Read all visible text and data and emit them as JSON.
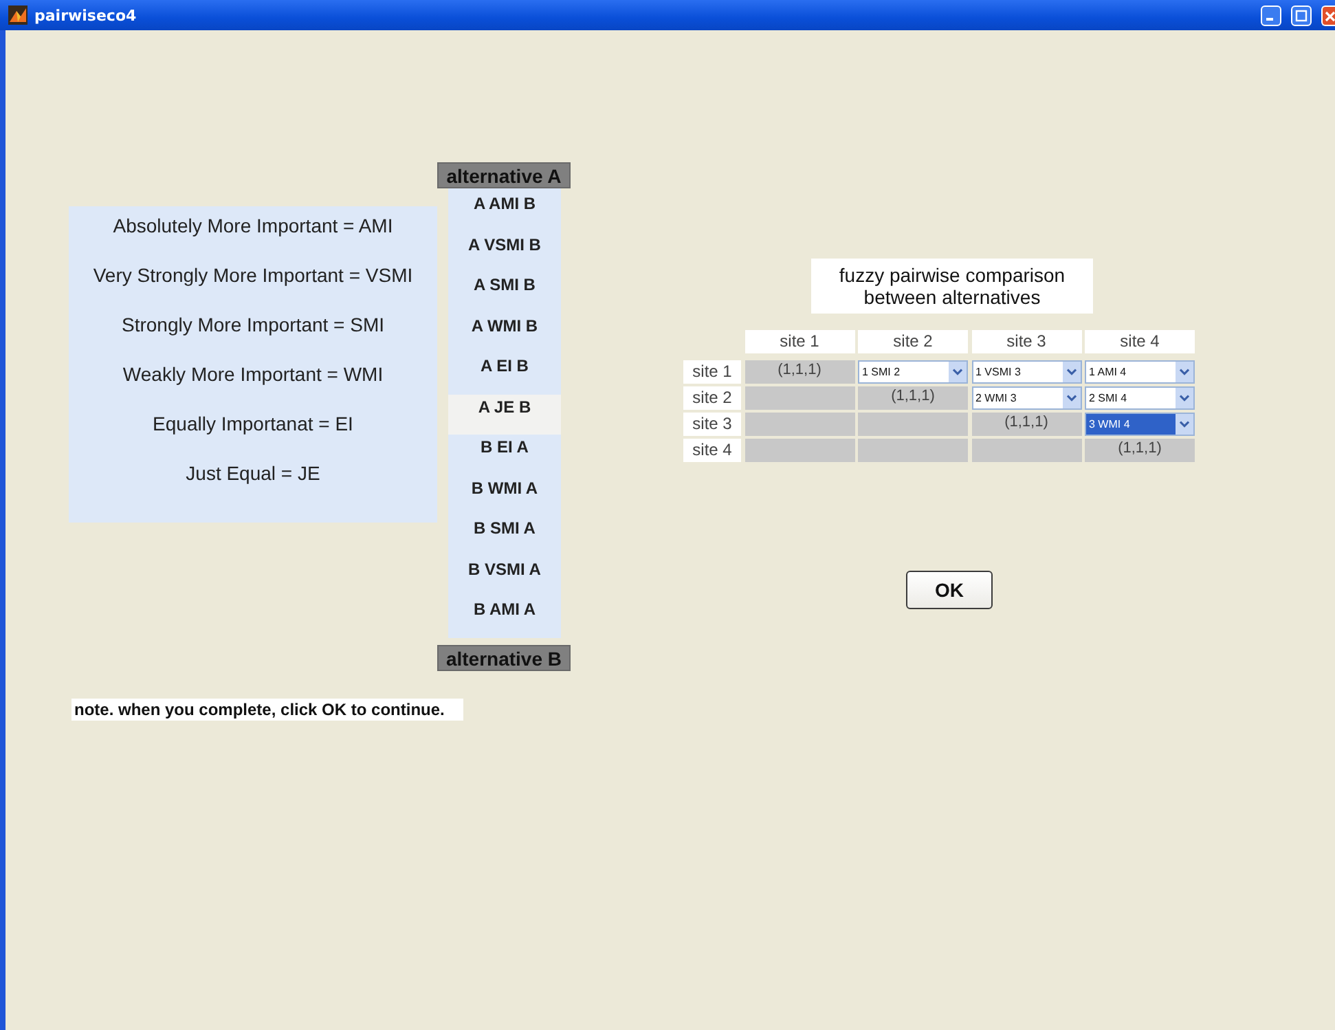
{
  "window": {
    "title": "pairwiseco4"
  },
  "legend": [
    "Absolutely More Important = AMI",
    "Very Strongly More Important = VSMI",
    "Strongly More Important = SMI",
    "Weakly More Important = WMI",
    "Equally Importanat = EI",
    "Just Equal = JE"
  ],
  "alternative_a": "alternative A",
  "scale_list": [
    {
      "label": "A AMI B",
      "selected": false
    },
    {
      "label": "A VSMI B",
      "selected": false
    },
    {
      "label": "A SMI B",
      "selected": false
    },
    {
      "label": "A WMI B",
      "selected": false
    },
    {
      "label": "A EI B",
      "selected": false
    },
    {
      "label": "A JE B",
      "selected": true
    },
    {
      "label": "B EI A",
      "selected": false
    },
    {
      "label": "B WMI A",
      "selected": false
    },
    {
      "label": "B SMI A",
      "selected": false
    },
    {
      "label": "B VSMI A",
      "selected": false
    },
    {
      "label": "B AMI A",
      "selected": false
    }
  ],
  "alternative_b": "alternative B",
  "note": "note. when you complete, click OK to continue.",
  "comparison_title": [
    "fuzzy pairwise comparison",
    "between alternatives"
  ],
  "table": {
    "columns": [
      "site 1",
      "site 2",
      "site 3",
      "site 4"
    ],
    "rows": [
      {
        "label": "site 1",
        "cells": [
          {
            "kind": "fixed",
            "text": "(1,1,1)"
          },
          {
            "kind": "dropdown",
            "text": "1 SMI 2",
            "focused": false
          },
          {
            "kind": "dropdown",
            "text": "1 VSMI 3",
            "focused": false
          },
          {
            "kind": "dropdown",
            "text": "1 AMI 4",
            "focused": false
          }
        ]
      },
      {
        "label": "site 2",
        "cells": [
          {
            "kind": "blank"
          },
          {
            "kind": "fixed",
            "text": "(1,1,1)"
          },
          {
            "kind": "dropdown",
            "text": "2 WMI 3",
            "focused": false
          },
          {
            "kind": "dropdown",
            "text": "2 SMI 4",
            "focused": false
          }
        ]
      },
      {
        "label": "site 3",
        "cells": [
          {
            "kind": "blank"
          },
          {
            "kind": "blank"
          },
          {
            "kind": "fixed",
            "text": "(1,1,1)"
          },
          {
            "kind": "dropdown",
            "text": "3 WMI 4",
            "focused": true
          }
        ]
      },
      {
        "label": "site 4",
        "cells": [
          {
            "kind": "blank"
          },
          {
            "kind": "blank"
          },
          {
            "kind": "blank"
          },
          {
            "kind": "fixed",
            "text": "(1,1,1)"
          }
        ]
      }
    ]
  },
  "ok_button": "OK"
}
